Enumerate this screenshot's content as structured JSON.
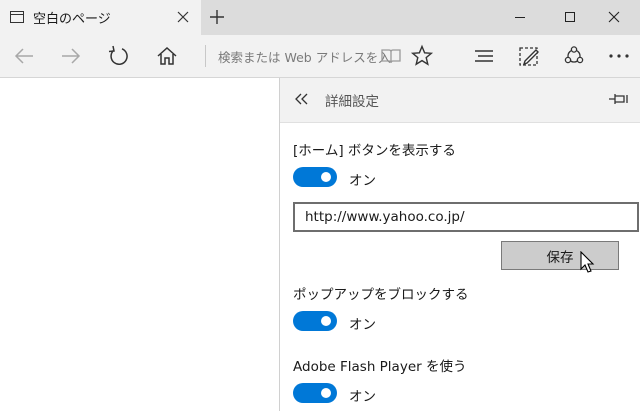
{
  "tab": {
    "title": "空白のページ"
  },
  "address_bar": {
    "placeholder": "検索または Web アドレスを入"
  },
  "panel": {
    "title": "詳細設定",
    "home_button": {
      "label": "[ホーム] ボタンを表示する",
      "toggle_state": "オン",
      "url_value": "http://www.yahoo.co.jp/",
      "save_label": "保存"
    },
    "popup": {
      "label": "ポップアップをブロックする",
      "toggle_state": "オン"
    },
    "flash": {
      "label": "Adobe Flash Player を使う",
      "toggle_state": "オン"
    }
  },
  "colors": {
    "accent": "#0078d7",
    "titlebar": "#dcdcdc",
    "toolbar": "#f2f2f2"
  },
  "icons": [
    "tab-page-icon",
    "tab-close-icon",
    "new-tab-icon",
    "minimize-icon",
    "maximize-icon",
    "close-icon",
    "back-icon",
    "forward-icon",
    "refresh-icon",
    "home-icon",
    "reading-view-icon",
    "favorite-star-icon",
    "hub-icon",
    "web-note-icon",
    "share-icon",
    "more-icon",
    "panel-back-icon",
    "pin-icon",
    "mouse-cursor-icon"
  ]
}
